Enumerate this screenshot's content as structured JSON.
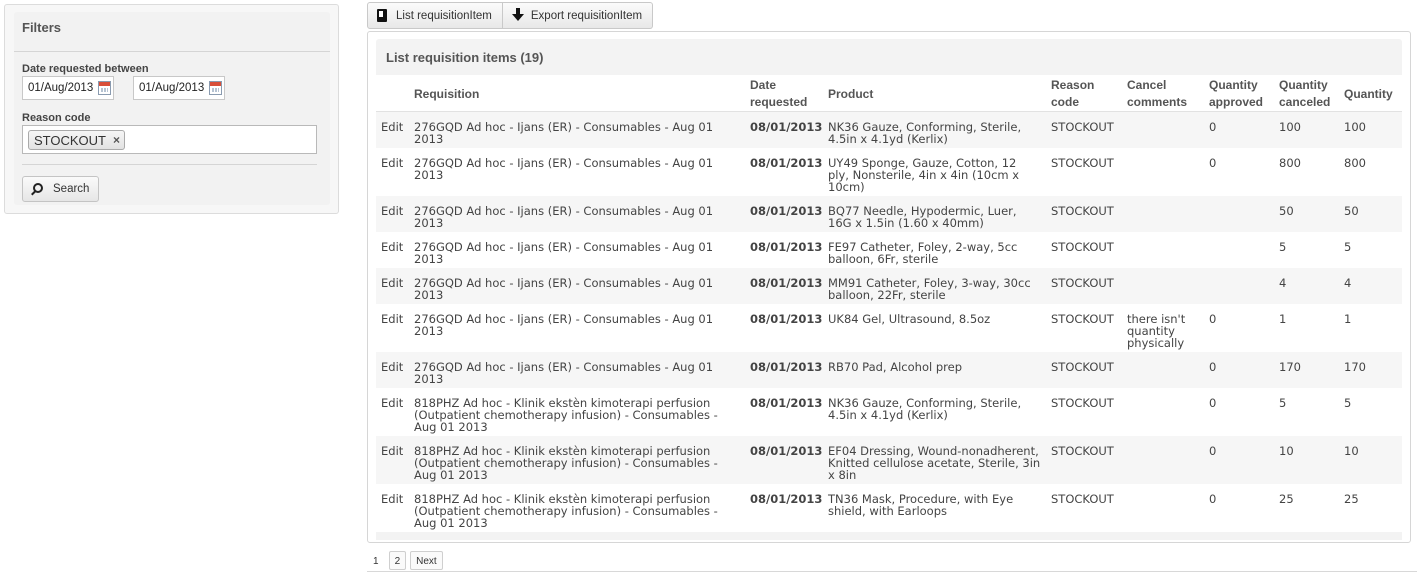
{
  "filters": {
    "title": "Filters",
    "date_label": "Date requested between",
    "date_from": "01/Aug/2013",
    "date_to": "01/Aug/2013",
    "reason_label": "Reason code",
    "reason_selected": "STOCKOUT",
    "search_label": "Search"
  },
  "toolbar": {
    "list_label": "List requisitionItem",
    "export_label": "Export requisitionItem"
  },
  "list": {
    "title": "List requisition items (19)",
    "columns": {
      "requisition": "Requisition",
      "date_requested_1": "Date",
      "date_requested_2": "requested",
      "product": "Product",
      "reason_code_1": "Reason",
      "reason_code_2": "code",
      "cancel_comments_1": "Cancel",
      "cancel_comments_2": "comments",
      "quantity_approved_1": "Quantity",
      "quantity_approved_2": "approved",
      "quantity_canceled_1": "Quantity",
      "quantity_canceled_2": "canceled",
      "quantity": "Quantity"
    },
    "rows": [
      {
        "edit": "Edit",
        "req1": "276GQD Ad hoc - Ijans (ER) - Consumables - Aug 01",
        "req2": "2013",
        "req3": "",
        "date": "08/01/2013",
        "prod1": "NK36 Gauze, Conforming, Sterile,",
        "prod2": "4.5in x 4.1yd (Kerlix)",
        "prod3": "",
        "reason": "STOCKOUT",
        "cc1": "",
        "cc2": "",
        "cc3": "",
        "approved": "0",
        "canceled": "100",
        "quantity": "100"
      },
      {
        "edit": "Edit",
        "req1": "276GQD Ad hoc - Ijans (ER) - Consumables - Aug 01",
        "req2": "2013",
        "req3": "",
        "date": "08/01/2013",
        "prod1": "UY49 Sponge, Gauze, Cotton, 12",
        "prod2": "ply, Nonsterile, 4in x 4in (10cm x",
        "prod3": "10cm)",
        "reason": "STOCKOUT",
        "cc1": "",
        "cc2": "",
        "cc3": "",
        "approved": "0",
        "canceled": "800",
        "quantity": "800"
      },
      {
        "edit": "Edit",
        "req1": "276GQD Ad hoc - Ijans (ER) - Consumables - Aug 01",
        "req2": "2013",
        "req3": "",
        "date": "08/01/2013",
        "prod1": "BQ77 Needle, Hypodermic, Luer,",
        "prod2": "16G x 1.5in (1.60 x 40mm)",
        "prod3": "",
        "reason": "STOCKOUT",
        "cc1": "",
        "cc2": "",
        "cc3": "",
        "approved": "",
        "canceled": "50",
        "quantity": "50"
      },
      {
        "edit": "Edit",
        "req1": "276GQD Ad hoc - Ijans (ER) - Consumables - Aug 01",
        "req2": "2013",
        "req3": "",
        "date": "08/01/2013",
        "prod1": "FE97 Catheter, Foley, 2-way, 5cc",
        "prod2": "balloon, 6Fr, sterile",
        "prod3": "",
        "reason": "STOCKOUT",
        "cc1": "",
        "cc2": "",
        "cc3": "",
        "approved": "",
        "canceled": "5",
        "quantity": "5"
      },
      {
        "edit": "Edit",
        "req1": "276GQD Ad hoc - Ijans (ER) - Consumables - Aug 01",
        "req2": "2013",
        "req3": "",
        "date": "08/01/2013",
        "prod1": "MM91 Catheter, Foley, 3-way, 30cc",
        "prod2": "balloon, 22Fr, sterile",
        "prod3": "",
        "reason": "STOCKOUT",
        "cc1": "",
        "cc2": "",
        "cc3": "",
        "approved": "",
        "canceled": "4",
        "quantity": "4"
      },
      {
        "edit": "Edit",
        "req1": "276GQD Ad hoc - Ijans (ER) - Consumables - Aug 01",
        "req2": "2013",
        "req3": "",
        "date": "08/01/2013",
        "prod1": "UK84 Gel, Ultrasound, 8.5oz",
        "prod2": "",
        "prod3": "",
        "reason": "STOCKOUT",
        "cc1": "there isn't",
        "cc2": "quantity",
        "cc3": "physically",
        "approved": "0",
        "canceled": "1",
        "quantity": "1"
      },
      {
        "edit": "Edit",
        "req1": "276GQD Ad hoc - Ijans (ER) - Consumables - Aug 01",
        "req2": "2013",
        "req3": "",
        "date": "08/01/2013",
        "prod1": "RB70 Pad, Alcohol prep",
        "prod2": "",
        "prod3": "",
        "reason": "STOCKOUT",
        "cc1": "",
        "cc2": "",
        "cc3": "",
        "approved": "0",
        "canceled": "170",
        "quantity": "170"
      },
      {
        "edit": "Edit",
        "req1": "818PHZ Ad hoc - Klinik ekstèn kimoterapi perfusion",
        "req2": "(Outpatient chemotherapy infusion) - Consumables -",
        "req3": "Aug 01 2013",
        "date": "08/01/2013",
        "prod1": "NK36 Gauze, Conforming, Sterile,",
        "prod2": "4.5in x 4.1yd (Kerlix)",
        "prod3": "",
        "reason": "STOCKOUT",
        "cc1": "",
        "cc2": "",
        "cc3": "",
        "approved": "0",
        "canceled": "5",
        "quantity": "5"
      },
      {
        "edit": "Edit",
        "req1": "818PHZ Ad hoc - Klinik ekstèn kimoterapi perfusion",
        "req2": "(Outpatient chemotherapy infusion) - Consumables -",
        "req3": "Aug 01 2013",
        "date": "08/01/2013",
        "prod1": "EF04 Dressing, Wound-nonadherent,",
        "prod2": "Knitted cellulose acetate, Sterile, 3in",
        "prod3": "x 8in",
        "reason": "STOCKOUT",
        "cc1": "",
        "cc2": "",
        "cc3": "",
        "approved": "0",
        "canceled": "10",
        "quantity": "10"
      },
      {
        "edit": "Edit",
        "req1": "818PHZ Ad hoc - Klinik ekstèn kimoterapi perfusion",
        "req2": "(Outpatient chemotherapy infusion) - Consumables -",
        "req3": "Aug 01 2013",
        "date": "08/01/2013",
        "prod1": "TN36 Mask, Procedure, with Eye",
        "prod2": "shield, with Earloops",
        "prod3": "",
        "reason": "STOCKOUT",
        "cc1": "",
        "cc2": "",
        "cc3": "",
        "approved": "0",
        "canceled": "25",
        "quantity": "25"
      }
    ]
  },
  "pagination": {
    "pages": [
      "1",
      "2"
    ],
    "next_label": "Next"
  }
}
